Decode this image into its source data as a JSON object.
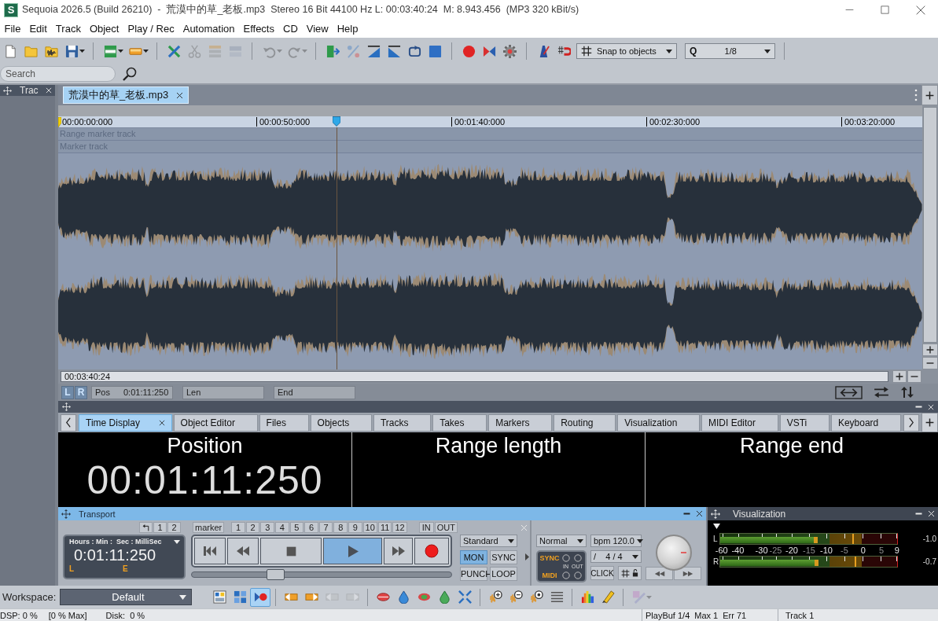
{
  "window": {
    "logo": "S",
    "title": "Sequoia 2026.5 (Build 26210)  -  荒漠中的草_老板.mp3  Stereo 16 Bit 44100 Hz L: 00:03:40:24  M: 8.943.456  (MP3 320 kBit/s)"
  },
  "menu": [
    "File",
    "Edit",
    "Track",
    "Object",
    "Play / Rec",
    "Automation",
    "Effects",
    "CD",
    "View",
    "Help"
  ],
  "toolbar": {
    "buttons": [
      {
        "disabled": false
      },
      {
        "disabled": false
      },
      {
        "disabled": false
      },
      {
        "disabled": false
      },
      {
        "disabled": false
      },
      {
        "disabled": false
      },
      {
        "disabled": false
      },
      {
        "disabled": true
      },
      {
        "disabled": true
      },
      {
        "disabled": true
      },
      {
        "disabled": true
      },
      {
        "disabled": true
      },
      {
        "disabled": false
      },
      {
        "disabled": true
      },
      {
        "disabled": false
      },
      {
        "disabled": false
      },
      {
        "disabled": false
      },
      {
        "disabled": false
      },
      {
        "disabled": false
      },
      {
        "disabled": false
      },
      {
        "disabled": false
      },
      {
        "disabled": false
      },
      {
        "disabled": false
      }
    ],
    "snap": {
      "value": "Snap to objects"
    },
    "quantize": {
      "label": "Q",
      "value": "1/8"
    }
  },
  "search": {
    "placeholder": "Search"
  },
  "track_panel": {
    "title": "Trac"
  },
  "document_tabs": [
    {
      "label": "荒漠中的草_老板.mp3",
      "selected": true
    }
  ],
  "cursor": {
    "level": 0.322
  },
  "ruler": [
    "00:00:00:000",
    "00:00:50:000",
    "00:01:40:000",
    "00:02:30:000",
    "00:03:20:000"
  ],
  "marker_tracks": [
    "Range marker track",
    "Marker track"
  ],
  "overview": {
    "length": "00:03:40:24"
  },
  "position_bar": {
    "channels": [
      "L",
      "R"
    ],
    "fields": [
      {
        "label": "Pos",
        "value": "0:01:11:250"
      },
      {
        "label": "Len"
      },
      {
        "label": "End"
      }
    ]
  },
  "panel_tabs": [
    {
      "label": "Time Display",
      "selected": true
    },
    {
      "label": "Object Editor",
      "selected": false
    },
    {
      "label": "Files",
      "selected": false
    },
    {
      "label": "Objects",
      "selected": false
    },
    {
      "label": "Tracks",
      "selected": false
    },
    {
      "label": "Takes",
      "selected": false
    },
    {
      "label": "Markers",
      "selected": false
    },
    {
      "label": "Routing",
      "selected": false
    },
    {
      "label": "Visualization",
      "selected": false
    },
    {
      "label": "MIDI Editor",
      "selected": false
    },
    {
      "label": "VSTi",
      "selected": false
    },
    {
      "label": "Keyboard",
      "selected": false
    }
  ],
  "time_display": [
    {
      "title": "Position",
      "value": "00:01:11:250"
    },
    {
      "title": "Range length"
    },
    {
      "title": "Range end"
    }
  ],
  "transport": {
    "title": "Transport",
    "undo_keys": [
      "1",
      "2"
    ],
    "marker_key": "marker",
    "marker_numbers": [
      "1",
      "2",
      "3",
      "4",
      "5",
      "6",
      "7",
      "8",
      "9",
      "10",
      "11",
      "12"
    ],
    "io_keys": [
      "IN",
      "OUT"
    ],
    "clock": {
      "format": "Hours : Min :  Sec : MilliSec",
      "value": "0:01:11:250",
      "flags": [
        "L",
        "E"
      ]
    },
    "buttons": [
      {
        "kind": "skip-start",
        "on": false
      },
      {
        "kind": "rewind",
        "on": false
      },
      {
        "kind": "stop",
        "on": false
      },
      {
        "kind": "play",
        "on": true
      },
      {
        "kind": "fast-forward",
        "on": false
      },
      {
        "kind": "record",
        "on": false
      }
    ],
    "position_slider": {
      "level": 0.31
    },
    "mode": "Standard",
    "toggles": [
      {
        "label": "MON",
        "on": true
      },
      {
        "label": "SYNC",
        "on": false
      },
      {
        "label": "PUNCH",
        "on": false
      },
      {
        "label": "LOOP",
        "on": false
      }
    ],
    "play_mode": "Normal",
    "sync_box": {
      "sync": "SYNC",
      "midi": "MIDI",
      "in": "IN",
      "out": "OUT"
    },
    "bpm": {
      "label": "bpm",
      "value": "120.0"
    },
    "signature": {
      "label": "/",
      "value": "4 / 4"
    },
    "click": "CLICK"
  },
  "visualization": {
    "title": "Visualization",
    "meters": [
      {
        "channel": "L",
        "level": 0.55,
        "peak": {
          "level": 0.746
        },
        "reading": "-1.0"
      },
      {
        "channel": "R",
        "level": 0.557,
        "peak": {
          "level": 0.76
        },
        "reading": "-0.7"
      }
    ],
    "scale": [
      {
        "label": "-60",
        "dim": false
      },
      {
        "label": "-40",
        "dim": false
      },
      {
        "label": "-30",
        "dim": false
      },
      {
        "label": "-25",
        "dim": true
      },
      {
        "label": "-20",
        "dim": false
      },
      {
        "label": "-15",
        "dim": true
      },
      {
        "label": "-10",
        "dim": false
      },
      {
        "label": "-5",
        "dim": true
      },
      {
        "label": "0",
        "dim": false
      },
      {
        "label": "5",
        "dim": true
      },
      {
        "label": "9",
        "dim": false
      }
    ]
  },
  "workspace": {
    "label": "Workspace:",
    "value": "Default",
    "buttons": [
      {
        "on": false,
        "disabled": false
      },
      {
        "on": false,
        "disabled": false
      },
      {
        "on": true,
        "disabled": false
      },
      {
        "on": false,
        "disabled": false
      },
      {
        "on": false,
        "disabled": false
      },
      {
        "on": false,
        "disabled": true
      },
      {
        "on": false,
        "disabled": true
      },
      {
        "on": false,
        "disabled": false
      },
      {
        "on": false,
        "disabled": false
      },
      {
        "on": false,
        "disabled": false
      },
      {
        "on": false,
        "disabled": false
      },
      {
        "on": false,
        "disabled": false
      },
      {
        "on": false,
        "disabled": false
      },
      {
        "on": false,
        "disabled": false
      },
      {
        "on": false,
        "disabled": false
      },
      {
        "on": false,
        "disabled": false
      },
      {
        "on": false,
        "disabled": false
      },
      {
        "on": false,
        "disabled": false
      },
      {
        "on": false,
        "disabled": true
      }
    ]
  },
  "status_bar": {
    "dsp": "DSP: 0 %",
    "dsp_max": "[0 % Max]",
    "disk": "Disk:  0 %",
    "playbuf": "PlayBuf 1/4",
    "max": "Max 1",
    "err": "Err 71",
    "track": "Track 1"
  }
}
